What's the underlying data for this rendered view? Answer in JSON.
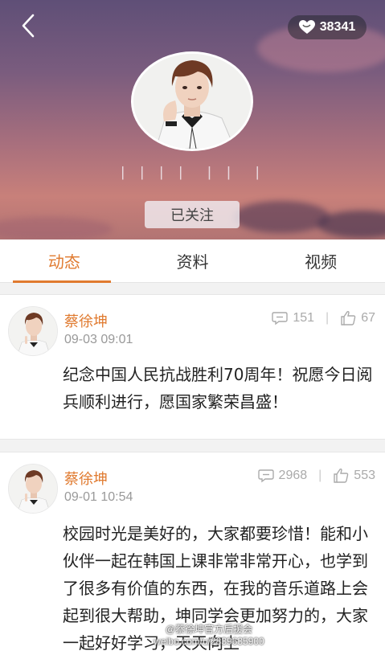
{
  "header": {
    "likes_count": "38341",
    "username": "丨丨丨丨 丨丨 丨",
    "follow_label": "已关注",
    "colors": {
      "accent": "#e07a2f"
    }
  },
  "tabs": [
    {
      "label": "动态",
      "active": true
    },
    {
      "label": "资料",
      "active": false
    },
    {
      "label": "视频",
      "active": false
    }
  ],
  "posts": [
    {
      "author": "蔡徐坤",
      "time": "09-03 09:01",
      "comments": "151",
      "likes": "67",
      "text": "纪念中国人民抗战胜利70周年！祝愿今日阅兵顺利进行，愿国家繁荣昌盛！"
    },
    {
      "author": "蔡徐坤",
      "time": "09-01 10:54",
      "comments": "2968",
      "likes": "553",
      "text": "校园时光是美好的，大家都要珍惜！能和小伙伴一起在韩国上课非常非常开心，也学到了很多有价值的东西，在我的音乐道路上会起到很大帮助，坤同学会更加努力的，大家一起好好学习，天天向上"
    }
  ],
  "watermark": "@蔡徐坤官方后援会\nweibo.com/u/2839635900",
  "icons": {
    "back": "chevron-left-icon",
    "heart": "heart-icon",
    "comment": "comment-icon",
    "like": "thumbs-up-icon"
  }
}
